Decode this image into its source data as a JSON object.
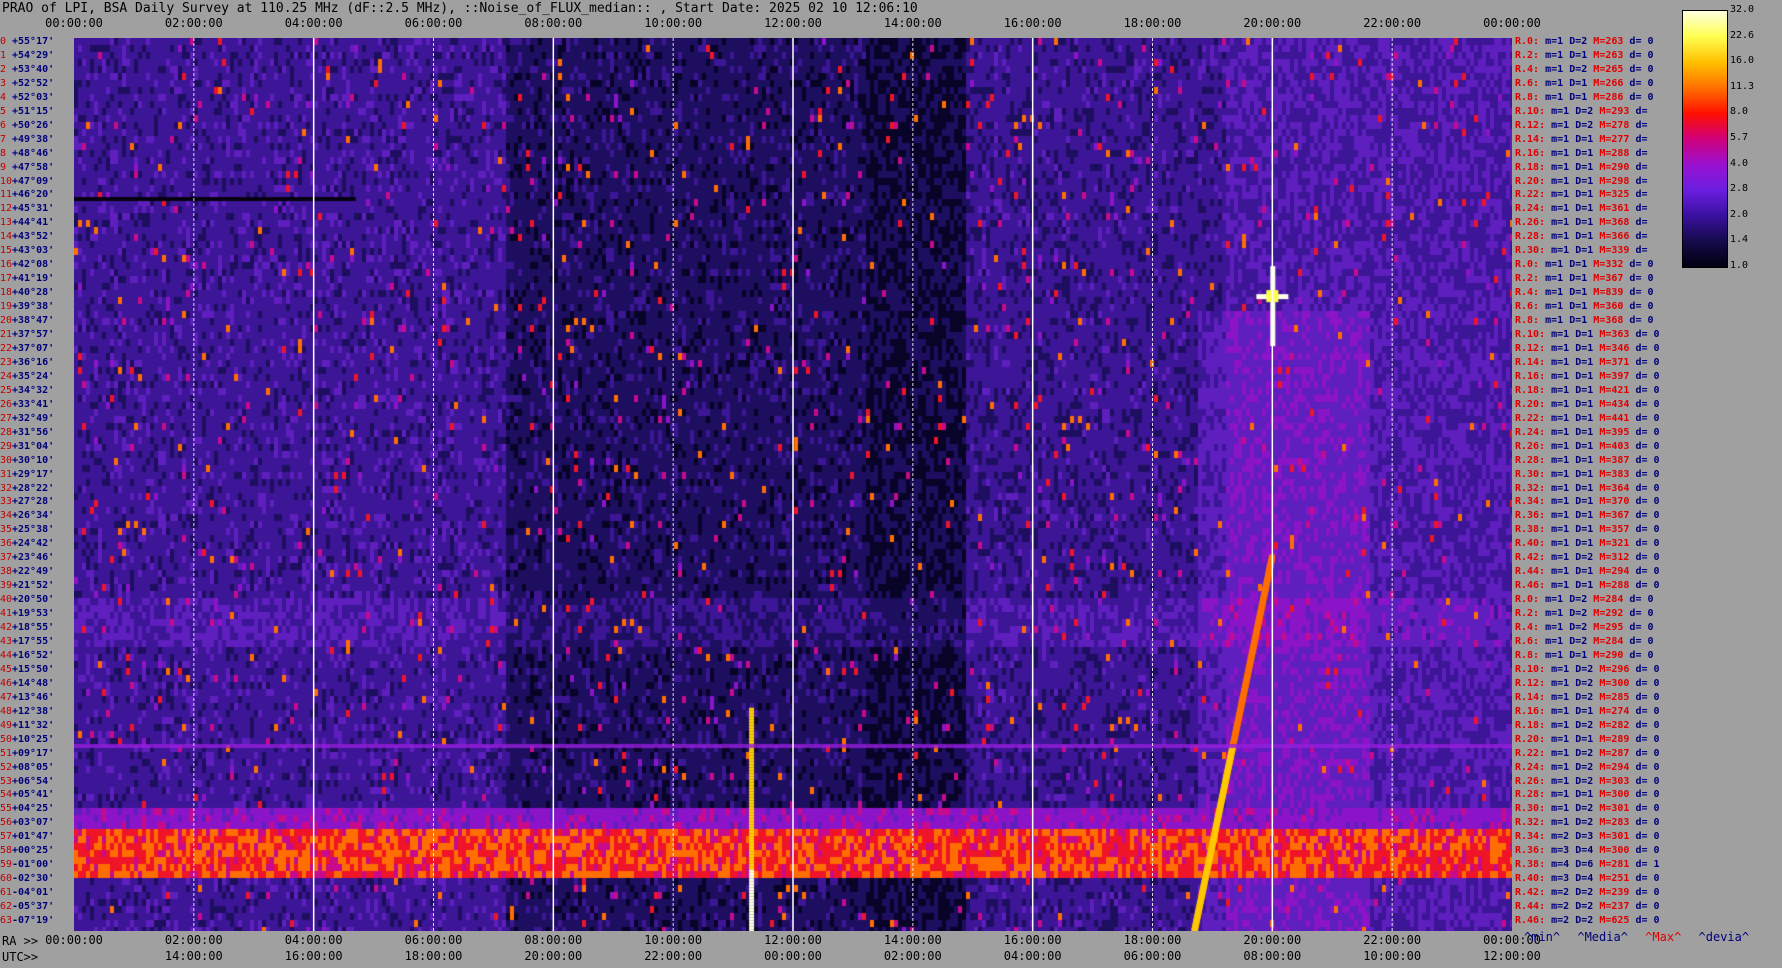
{
  "title": "PRAO of LPI, BSA Daily Survey at 110.25 MHz (dF::2.5 MHz), ::Noise_of_FLUX_median:: , Start Date: 2025 02 10 12:06:10",
  "chart_data": {
    "type": "heatmap",
    "title": "PRAO of LPI, BSA Daily Survey at 110.25 MHz (dF::2.5 MHz), ::Noise_of_FLUX_median:: , Start Date: 2025 02 10 12:06:10",
    "top_ticks": [
      "00:00:00",
      "02:00:00",
      "04:00:00",
      "06:00:00",
      "08:00:00",
      "10:00:00",
      "12:00:00",
      "14:00:00",
      "16:00:00",
      "18:00:00",
      "20:00:00",
      "22:00:00",
      "00:00:00"
    ],
    "ra_label": "RA >>",
    "ra_ticks": [
      "00:00:00",
      "02:00:00",
      "04:00:00",
      "06:00:00",
      "08:00:00",
      "10:00:00",
      "12:00:00",
      "14:00:00",
      "16:00:00",
      "18:00:00",
      "20:00:00",
      "22:00:00",
      "00:00:00"
    ],
    "utc_label": "UTC>>",
    "utc_ticks": [
      "14:00:00",
      "16:00:00",
      "18:00:00",
      "20:00:00",
      "22:00:00",
      "00:00:00",
      "02:00:00",
      "04:00:00",
      "06:00:00",
      "08:00:00",
      "10:00:00",
      "12:00:00"
    ],
    "colorbar_ticks": [
      "32.0",
      "22.6",
      "16.0",
      "11.3",
      "8.0",
      "5.7",
      "4.0",
      "2.8",
      "2.0",
      "1.4",
      "1.0"
    ],
    "colorbar_colors": [
      "#ffffe0",
      "#ffff50",
      "#ffc000",
      "#ff7000",
      "#ff1000",
      "#d0007a",
      "#9a10d0",
      "#6a1ee0",
      "#3a10a0",
      "#150a4a",
      "#000010"
    ],
    "rows": [
      {
        "i": "0",
        "dec": "+55°17'"
      },
      {
        "i": "1",
        "dec": "+54°29'"
      },
      {
        "i": "2",
        "dec": "+53°40'"
      },
      {
        "i": "3",
        "dec": "+52°52'"
      },
      {
        "i": "4",
        "dec": "+52°03'"
      },
      {
        "i": "5",
        "dec": "+51°15'"
      },
      {
        "i": "6",
        "dec": "+50°26'"
      },
      {
        "i": "7",
        "dec": "+49°38'"
      },
      {
        "i": "8",
        "dec": "+48°46'"
      },
      {
        "i": "9",
        "dec": "+47°58'"
      },
      {
        "i": "10",
        "dec": "+47°09'"
      },
      {
        "i": "11",
        "dec": "+46°20'"
      },
      {
        "i": "12",
        "dec": "+45°31'"
      },
      {
        "i": "13",
        "dec": "+44°41'"
      },
      {
        "i": "14",
        "dec": "+43°52'"
      },
      {
        "i": "15",
        "dec": "+43°03'"
      },
      {
        "i": "16",
        "dec": "+42°08'"
      },
      {
        "i": "17",
        "dec": "+41°19'"
      },
      {
        "i": "18",
        "dec": "+40°28'"
      },
      {
        "i": "19",
        "dec": "+39°38'"
      },
      {
        "i": "20",
        "dec": "+38°47'"
      },
      {
        "i": "21",
        "dec": "+37°57'"
      },
      {
        "i": "22",
        "dec": "+37°07'"
      },
      {
        "i": "23",
        "dec": "+36°16'"
      },
      {
        "i": "24",
        "dec": "+35°24'"
      },
      {
        "i": "25",
        "dec": "+34°32'"
      },
      {
        "i": "26",
        "dec": "+33°41'"
      },
      {
        "i": "27",
        "dec": "+32°49'"
      },
      {
        "i": "28",
        "dec": "+31°56'"
      },
      {
        "i": "29",
        "dec": "+31°04'"
      },
      {
        "i": "30",
        "dec": "+30°10'"
      },
      {
        "i": "31",
        "dec": "+29°17'"
      },
      {
        "i": "32",
        "dec": "+28°22'"
      },
      {
        "i": "33",
        "dec": "+27°28'"
      },
      {
        "i": "34",
        "dec": "+26°34'"
      },
      {
        "i": "35",
        "dec": "+25°38'"
      },
      {
        "i": "36",
        "dec": "+24°42'"
      },
      {
        "i": "37",
        "dec": "+23°46'"
      },
      {
        "i": "38",
        "dec": "+22°49'"
      },
      {
        "i": "39",
        "dec": "+21°52'"
      },
      {
        "i": "40",
        "dec": "+20°50'"
      },
      {
        "i": "41",
        "dec": "+19°53'"
      },
      {
        "i": "42",
        "dec": "+18°55'"
      },
      {
        "i": "43",
        "dec": "+17°55'"
      },
      {
        "i": "44",
        "dec": "+16°52'"
      },
      {
        "i": "45",
        "dec": "+15°50'"
      },
      {
        "i": "46",
        "dec": "+14°48'"
      },
      {
        "i": "47",
        "dec": "+13°46'"
      },
      {
        "i": "48",
        "dec": "+12°38'"
      },
      {
        "i": "49",
        "dec": "+11°32'"
      },
      {
        "i": "50",
        "dec": "+10°25'"
      },
      {
        "i": "51",
        "dec": "+09°17'"
      },
      {
        "i": "52",
        "dec": "+08°05'"
      },
      {
        "i": "53",
        "dec": "+06°54'"
      },
      {
        "i": "54",
        "dec": "+05°41'"
      },
      {
        "i": "55",
        "dec": "+04°25'"
      },
      {
        "i": "56",
        "dec": "+03°07'"
      },
      {
        "i": "57",
        "dec": "+01°47'"
      },
      {
        "i": "58",
        "dec": "+00°25'"
      },
      {
        "i": "59",
        "dec": "-01°00'"
      },
      {
        "i": "60",
        "dec": "-02°30'"
      },
      {
        "i": "61",
        "dec": "-04°01'"
      },
      {
        "i": "62",
        "dec": "-05°37'"
      },
      {
        "i": "63",
        "dec": "-07°19'"
      }
    ],
    "stats": [
      {
        "r": "R.0:",
        "m": "m=1",
        "d": "D=2",
        "M": "M=263",
        "dev": "d= 0"
      },
      {
        "r": "R.2:",
        "m": "m=1",
        "d": "D=1",
        "M": "M=263",
        "dev": "d= 0"
      },
      {
        "r": "R.4:",
        "m": "m=1",
        "d": "D=2",
        "M": "M=265",
        "dev": "d= 0"
      },
      {
        "r": "R.6:",
        "m": "m=1",
        "d": "D=1",
        "M": "M=266",
        "dev": "d= 0"
      },
      {
        "r": "R.8:",
        "m": "m=1",
        "d": "D=1",
        "M": "M=286",
        "dev": "d= 0"
      },
      {
        "r": "R.10:",
        "m": "m=1",
        "d": "D=2",
        "M": "M=293",
        "dev": "d="
      },
      {
        "r": "R.12:",
        "m": "m=1",
        "d": "D=2",
        "M": "M=278",
        "dev": "d="
      },
      {
        "r": "R.14:",
        "m": "m=1",
        "d": "D=1",
        "M": "M=277",
        "dev": "d="
      },
      {
        "r": "R.16:",
        "m": "m=1",
        "d": "D=1",
        "M": "M=288",
        "dev": "d="
      },
      {
        "r": "R.18:",
        "m": "m=1",
        "d": "D=1",
        "M": "M=290",
        "dev": "d="
      },
      {
        "r": "R.20:",
        "m": "m=1",
        "d": "D=1",
        "M": "M=298",
        "dev": "d="
      },
      {
        "r": "R.22:",
        "m": "m=1",
        "d": "D=1",
        "M": "M=325",
        "dev": "d="
      },
      {
        "r": "R.24:",
        "m": "m=1",
        "d": "D=1",
        "M": "M=361",
        "dev": "d="
      },
      {
        "r": "R.26:",
        "m": "m=1",
        "d": "D=1",
        "M": "M=368",
        "dev": "d="
      },
      {
        "r": "R.28:",
        "m": "m=1",
        "d": "D=1",
        "M": "M=366",
        "dev": "d="
      },
      {
        "r": "R.30:",
        "m": "m=1",
        "d": "D=1",
        "M": "M=339",
        "dev": "d="
      },
      {
        "r": "R.0:",
        "m": "m=1",
        "d": "D=1",
        "M": "M=332",
        "dev": "d= 0"
      },
      {
        "r": "R.2:",
        "m": "m=1",
        "d": "D=1",
        "M": "M=367",
        "dev": "d= 0"
      },
      {
        "r": "R.4:",
        "m": "m=1",
        "d": "D=1",
        "M": "M=839",
        "dev": "d= 0"
      },
      {
        "r": "R.6:",
        "m": "m=1",
        "d": "D=1",
        "M": "M=360",
        "dev": "d= 0"
      },
      {
        "r": "R.8:",
        "m": "m=1",
        "d": "D=1",
        "M": "M=368",
        "dev": "d= 0"
      },
      {
        "r": "R.10:",
        "m": "m=1",
        "d": "D=1",
        "M": "M=363",
        "dev": "d= 0"
      },
      {
        "r": "R.12:",
        "m": "m=1",
        "d": "D=1",
        "M": "M=346",
        "dev": "d= 0"
      },
      {
        "r": "R.14:",
        "m": "m=1",
        "d": "D=1",
        "M": "M=371",
        "dev": "d= 0"
      },
      {
        "r": "R.16:",
        "m": "m=1",
        "d": "D=1",
        "M": "M=397",
        "dev": "d= 0"
      },
      {
        "r": "R.18:",
        "m": "m=1",
        "d": "D=1",
        "M": "M=421",
        "dev": "d= 0"
      },
      {
        "r": "R.20:",
        "m": "m=1",
        "d": "D=1",
        "M": "M=434",
        "dev": "d= 0"
      },
      {
        "r": "R.22:",
        "m": "m=1",
        "d": "D=1",
        "M": "M=441",
        "dev": "d= 0"
      },
      {
        "r": "R.24:",
        "m": "m=1",
        "d": "D=1",
        "M": "M=395",
        "dev": "d= 0"
      },
      {
        "r": "R.26:",
        "m": "m=1",
        "d": "D=1",
        "M": "M=403",
        "dev": "d= 0"
      },
      {
        "r": "R.28:",
        "m": "m=1",
        "d": "D=1",
        "M": "M=387",
        "dev": "d= 0"
      },
      {
        "r": "R.30:",
        "m": "m=1",
        "d": "D=1",
        "M": "M=383",
        "dev": "d= 0"
      },
      {
        "r": "R.32:",
        "m": "m=1",
        "d": "D=1",
        "M": "M=364",
        "dev": "d= 0"
      },
      {
        "r": "R.34:",
        "m": "m=1",
        "d": "D=1",
        "M": "M=370",
        "dev": "d= 0"
      },
      {
        "r": "R.36:",
        "m": "m=1",
        "d": "D=1",
        "M": "M=367",
        "dev": "d= 0"
      },
      {
        "r": "R.38:",
        "m": "m=1",
        "d": "D=1",
        "M": "M=357",
        "dev": "d= 0"
      },
      {
        "r": "R.40:",
        "m": "m=1",
        "d": "D=1",
        "M": "M=321",
        "dev": "d= 0"
      },
      {
        "r": "R.42:",
        "m": "m=1",
        "d": "D=2",
        "M": "M=312",
        "dev": "d= 0"
      },
      {
        "r": "R.44:",
        "m": "m=1",
        "d": "D=1",
        "M": "M=294",
        "dev": "d= 0"
      },
      {
        "r": "R.46:",
        "m": "m=1",
        "d": "D=1",
        "M": "M=288",
        "dev": "d= 0"
      },
      {
        "r": "R.0:",
        "m": "m=1",
        "d": "D=2",
        "M": "M=284",
        "dev": "d= 0"
      },
      {
        "r": "R.2:",
        "m": "m=1",
        "d": "D=2",
        "M": "M=292",
        "dev": "d= 0"
      },
      {
        "r": "R.4:",
        "m": "m=1",
        "d": "D=2",
        "M": "M=295",
        "dev": "d= 0"
      },
      {
        "r": "R.6:",
        "m": "m=1",
        "d": "D=2",
        "M": "M=284",
        "dev": "d= 0"
      },
      {
        "r": "R.8:",
        "m": "m=1",
        "d": "D=1",
        "M": "M=290",
        "dev": "d= 0"
      },
      {
        "r": "R.10:",
        "m": "m=1",
        "d": "D=2",
        "M": "M=296",
        "dev": "d= 0"
      },
      {
        "r": "R.12:",
        "m": "m=1",
        "d": "D=2",
        "M": "M=300",
        "dev": "d= 0"
      },
      {
        "r": "R.14:",
        "m": "m=1",
        "d": "D=2",
        "M": "M=285",
        "dev": "d= 0"
      },
      {
        "r": "R.16:",
        "m": "m=1",
        "d": "D=1",
        "M": "M=274",
        "dev": "d= 0"
      },
      {
        "r": "R.18:",
        "m": "m=1",
        "d": "D=2",
        "M": "M=282",
        "dev": "d= 0"
      },
      {
        "r": "R.20:",
        "m": "m=1",
        "d": "D=1",
        "M": "M=289",
        "dev": "d= 0"
      },
      {
        "r": "R.22:",
        "m": "m=1",
        "d": "D=2",
        "M": "M=287",
        "dev": "d= 0"
      },
      {
        "r": "R.24:",
        "m": "m=1",
        "d": "D=2",
        "M": "M=294",
        "dev": "d= 0"
      },
      {
        "r": "R.26:",
        "m": "m=1",
        "d": "D=2",
        "M": "M=303",
        "dev": "d= 0"
      },
      {
        "r": "R.28:",
        "m": "m=1",
        "d": "D=1",
        "M": "M=300",
        "dev": "d= 0"
      },
      {
        "r": "R.30:",
        "m": "m=1",
        "d": "D=2",
        "M": "M=301",
        "dev": "d= 0"
      },
      {
        "r": "R.32:",
        "m": "m=1",
        "d": "D=2",
        "M": "M=283",
        "dev": "d= 0"
      },
      {
        "r": "R.34:",
        "m": "m=2",
        "d": "D=3",
        "M": "M=301",
        "dev": "d= 0"
      },
      {
        "r": "R.36:",
        "m": "m=3",
        "d": "D=4",
        "M": "M=300",
        "dev": "d= 0"
      },
      {
        "r": "R.38:",
        "m": "m=4",
        "d": "D=6",
        "M": "M=281",
        "dev": "d= 1"
      },
      {
        "r": "R.40:",
        "m": "m=3",
        "d": "D=4",
        "M": "M=251",
        "dev": "d= 0"
      },
      {
        "r": "R.42:",
        "m": "m=2",
        "d": "D=2",
        "M": "M=239",
        "dev": "d= 0"
      },
      {
        "r": "R.44:",
        "m": "m=2",
        "d": "D=2",
        "M": "M=237",
        "dev": "d= 0"
      },
      {
        "r": "R.46:",
        "m": "m=2",
        "d": "D=2",
        "M": "M=625",
        "dev": "d= 0"
      }
    ],
    "legend": {
      "min": "^min^",
      "median": "^Media^",
      "max": "^Max^",
      "dev": "^devia^"
    },
    "features": {
      "strong_band_dec": "-01°00'",
      "bright_point_ra_hours": 20.0,
      "bright_point_dec": "+40°28'",
      "diagonal_streak_ra_start": 18.7,
      "diagonal_streak_ra_end": 20.0
    }
  }
}
